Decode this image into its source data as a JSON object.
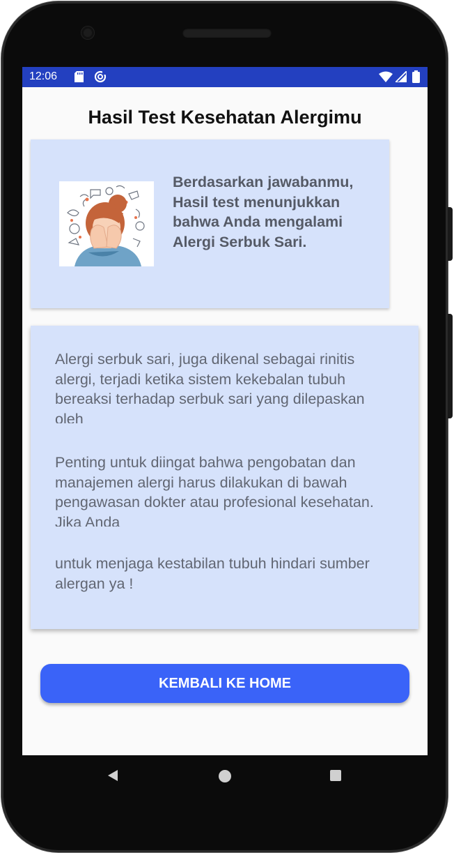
{
  "status_bar": {
    "time": "12:06",
    "left_icons": [
      "sd-card-icon",
      "data-saver-icon"
    ],
    "right_icons": [
      "wifi-icon",
      "signal-icon",
      "battery-icon"
    ]
  },
  "page": {
    "title": "Hasil Test Kesehatan Alergimu"
  },
  "result_card": {
    "image": "woman-allergy-illustration",
    "text": "Berdasarkan jawabanmu, Hasil test menunjukkan bahwa Anda mengalami Alergi Serbuk Sari."
  },
  "info_card": {
    "paragraph_1": "Alergi serbuk sari, juga dikenal sebagai rinitis alergi, terjadi ketika sistem kekebalan tubuh bereaksi terhadap serbuk sari yang dilepaskan oleh",
    "paragraph_2": "Penting untuk diingat bahwa pengobatan dan manajemen alergi harus dilakukan di bawah pengawasan dokter atau profesional kesehatan. Jika Anda",
    "paragraph_3": "untuk menjaga kestabilan tubuh hindari sumber alergan ya !"
  },
  "actions": {
    "home_button_label": "KEMBALI KE HOME"
  },
  "nav_bar": {
    "icons": [
      "back-icon",
      "home-icon",
      "recents-icon"
    ]
  },
  "colors": {
    "status_bar": "#2340c0",
    "card_background": "#d6e2fb",
    "button": "#3a63f8",
    "screen_background": "#fafafa"
  }
}
